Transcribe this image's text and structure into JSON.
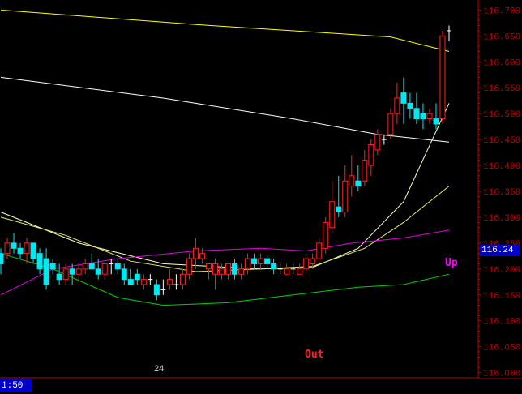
{
  "chart_data": {
    "type": "candlestick",
    "ylim": [
      115.99,
      116.71
    ],
    "y_ticks": [
      "116.000",
      "116.050",
      "116.100",
      "116.150",
      "116.200",
      "116.250",
      "116.300",
      "116.350",
      "116.400",
      "116.450",
      "116.500",
      "116.550",
      "116.600",
      "116.650",
      "116.700"
    ],
    "y_tick_values": [
      116.0,
      116.05,
      116.1,
      116.15,
      116.2,
      116.25,
      116.3,
      116.35,
      116.4,
      116.45,
      116.5,
      116.55,
      116.6,
      116.65,
      116.7
    ],
    "candles": [
      {
        "o": 116.23,
        "h": 116.24,
        "l": 116.19,
        "c": 116.21,
        "up": false
      },
      {
        "o": 116.23,
        "h": 116.26,
        "l": 116.22,
        "c": 116.25,
        "up": true
      },
      {
        "o": 116.25,
        "h": 116.27,
        "l": 116.23,
        "c": 116.24,
        "up": false
      },
      {
        "o": 116.24,
        "h": 116.25,
        "l": 116.22,
        "c": 116.23,
        "up": false
      },
      {
        "o": 116.23,
        "h": 116.26,
        "l": 116.21,
        "c": 116.25,
        "up": true
      },
      {
        "o": 116.25,
        "h": 116.25,
        "l": 116.21,
        "c": 116.22,
        "up": false
      },
      {
        "o": 116.23,
        "h": 116.24,
        "l": 116.19,
        "c": 116.2,
        "up": false
      },
      {
        "o": 116.22,
        "h": 116.24,
        "l": 116.16,
        "c": 116.17,
        "up": false
      },
      {
        "o": 116.21,
        "h": 116.22,
        "l": 116.19,
        "c": 116.2,
        "up": false
      },
      {
        "o": 116.19,
        "h": 116.21,
        "l": 116.17,
        "c": 116.18,
        "up": false
      },
      {
        "o": 116.18,
        "h": 116.21,
        "l": 116.17,
        "c": 116.2,
        "up": true
      },
      {
        "o": 116.2,
        "h": 116.21,
        "l": 116.17,
        "c": 116.19,
        "up": false
      },
      {
        "o": 116.19,
        "h": 116.21,
        "l": 116.18,
        "c": 116.2,
        "up": true
      },
      {
        "o": 116.2,
        "h": 116.22,
        "l": 116.19,
        "c": 116.21,
        "up": true
      },
      {
        "o": 116.21,
        "h": 116.23,
        "l": 116.2,
        "c": 116.2,
        "up": false
      },
      {
        "o": 116.2,
        "h": 116.22,
        "l": 116.18,
        "c": 116.19,
        "up": false
      },
      {
        "o": 116.19,
        "h": 116.21,
        "l": 116.18,
        "c": 116.21,
        "up": true
      },
      {
        "o": 116.21,
        "h": 116.22,
        "l": 116.19,
        "c": 116.21,
        "up": false
      },
      {
        "o": 116.21,
        "h": 116.22,
        "l": 116.19,
        "c": 116.2,
        "up": false
      },
      {
        "o": 116.2,
        "h": 116.21,
        "l": 116.17,
        "c": 116.18,
        "up": false
      },
      {
        "o": 116.18,
        "h": 116.2,
        "l": 116.17,
        "c": 116.17,
        "up": false
      },
      {
        "o": 116.18,
        "h": 116.2,
        "l": 116.17,
        "c": 116.19,
        "up": false
      },
      {
        "o": 116.17,
        "h": 116.19,
        "l": 116.16,
        "c": 116.18,
        "up": true
      },
      {
        "o": 116.18,
        "h": 116.19,
        "l": 116.17,
        "c": 116.18,
        "up": false
      },
      {
        "o": 116.17,
        "h": 116.18,
        "l": 116.14,
        "c": 116.15,
        "up": false
      },
      {
        "o": 116.16,
        "h": 116.18,
        "l": 116.15,
        "c": 116.16,
        "up": true
      },
      {
        "o": 116.17,
        "h": 116.2,
        "l": 116.16,
        "c": 116.18,
        "up": true
      },
      {
        "o": 116.17,
        "h": 116.19,
        "l": 116.16,
        "c": 116.17,
        "up": false
      },
      {
        "o": 116.17,
        "h": 116.2,
        "l": 116.16,
        "c": 116.19,
        "up": true
      },
      {
        "o": 116.19,
        "h": 116.23,
        "l": 116.18,
        "c": 116.22,
        "up": true
      },
      {
        "o": 116.22,
        "h": 116.26,
        "l": 116.2,
        "c": 116.24,
        "up": true
      },
      {
        "o": 116.22,
        "h": 116.24,
        "l": 116.21,
        "c": 116.23,
        "up": true
      },
      {
        "o": 116.2,
        "h": 116.21,
        "l": 116.18,
        "c": 116.21,
        "up": true
      },
      {
        "o": 116.19,
        "h": 116.22,
        "l": 116.16,
        "c": 116.21,
        "up": true
      },
      {
        "o": 116.19,
        "h": 116.21,
        "l": 116.18,
        "c": 116.2,
        "up": true
      },
      {
        "o": 116.19,
        "h": 116.21,
        "l": 116.18,
        "c": 116.21,
        "up": true
      },
      {
        "o": 116.21,
        "h": 116.22,
        "l": 116.18,
        "c": 116.19,
        "up": false
      },
      {
        "o": 116.19,
        "h": 116.21,
        "l": 116.18,
        "c": 116.2,
        "up": true
      },
      {
        "o": 116.2,
        "h": 116.23,
        "l": 116.19,
        "c": 116.22,
        "up": true
      },
      {
        "o": 116.22,
        "h": 116.23,
        "l": 116.2,
        "c": 116.21,
        "up": false
      },
      {
        "o": 116.21,
        "h": 116.23,
        "l": 116.2,
        "c": 116.22,
        "up": true
      },
      {
        "o": 116.22,
        "h": 116.23,
        "l": 116.2,
        "c": 116.21,
        "up": false
      },
      {
        "o": 116.21,
        "h": 116.22,
        "l": 116.19,
        "c": 116.2,
        "up": false
      },
      {
        "o": 116.2,
        "h": 116.21,
        "l": 116.19,
        "c": 116.2,
        "up": false
      },
      {
        "o": 116.19,
        "h": 116.21,
        "l": 116.19,
        "c": 116.2,
        "up": true
      },
      {
        "o": 116.2,
        "h": 116.21,
        "l": 116.19,
        "c": 116.2,
        "up": false
      },
      {
        "o": 116.19,
        "h": 116.21,
        "l": 116.19,
        "c": 116.2,
        "up": true
      },
      {
        "o": 116.2,
        "h": 116.23,
        "l": 116.19,
        "c": 116.22,
        "up": true
      },
      {
        "o": 116.21,
        "h": 116.23,
        "l": 116.2,
        "c": 116.22,
        "up": true
      },
      {
        "o": 116.22,
        "h": 116.26,
        "l": 116.21,
        "c": 116.25,
        "up": true
      },
      {
        "o": 116.24,
        "h": 116.3,
        "l": 116.23,
        "c": 116.29,
        "up": true
      },
      {
        "o": 116.28,
        "h": 116.37,
        "l": 116.27,
        "c": 116.33,
        "up": true
      },
      {
        "o": 116.32,
        "h": 116.38,
        "l": 116.3,
        "c": 116.31,
        "up": false
      },
      {
        "o": 116.31,
        "h": 116.4,
        "l": 116.3,
        "c": 116.37,
        "up": true
      },
      {
        "o": 116.36,
        "h": 116.42,
        "l": 116.34,
        "c": 116.38,
        "up": true
      },
      {
        "o": 116.37,
        "h": 116.4,
        "l": 116.35,
        "c": 116.36,
        "up": false
      },
      {
        "o": 116.37,
        "h": 116.43,
        "l": 116.36,
        "c": 116.41,
        "up": true
      },
      {
        "o": 116.4,
        "h": 116.45,
        "l": 116.38,
        "c": 116.44,
        "up": true
      },
      {
        "o": 116.43,
        "h": 116.47,
        "l": 116.42,
        "c": 116.46,
        "up": true
      },
      {
        "o": 116.45,
        "h": 116.46,
        "l": 116.44,
        "c": 116.45,
        "up": true
      },
      {
        "o": 116.46,
        "h": 116.51,
        "l": 116.45,
        "c": 116.5,
        "up": true
      },
      {
        "o": 116.5,
        "h": 116.56,
        "l": 116.48,
        "c": 116.53,
        "up": true
      },
      {
        "o": 116.54,
        "h": 116.57,
        "l": 116.48,
        "c": 116.52,
        "up": false
      },
      {
        "o": 116.52,
        "h": 116.54,
        "l": 116.49,
        "c": 116.51,
        "up": false
      },
      {
        "o": 116.51,
        "h": 116.54,
        "l": 116.48,
        "c": 116.49,
        "up": false
      },
      {
        "o": 116.5,
        "h": 116.52,
        "l": 116.47,
        "c": 116.49,
        "up": false
      },
      {
        "o": 116.49,
        "h": 116.51,
        "l": 116.48,
        "c": 116.5,
        "up": true
      },
      {
        "o": 116.49,
        "h": 116.52,
        "l": 116.47,
        "c": 116.48,
        "up": false
      },
      {
        "o": 116.49,
        "h": 116.66,
        "l": 116.48,
        "c": 116.65,
        "up": true
      },
      {
        "o": 116.66,
        "h": 116.67,
        "l": 116.64,
        "c": 116.66,
        "up": true
      }
    ],
    "lines": [
      {
        "color": "#ffff00",
        "points": [
          [
            0,
            116.7
          ],
          [
            30,
            116.672
          ],
          [
            60,
            116.648
          ],
          [
            69,
            116.62
          ]
        ]
      },
      {
        "color": "#fffff0",
        "points": [
          [
            0,
            116.57
          ],
          [
            25,
            116.53
          ],
          [
            45,
            116.49
          ],
          [
            58,
            116.46
          ],
          [
            69,
            116.445
          ]
        ]
      },
      {
        "color": "#ffffc0",
        "points": [
          [
            0,
            116.31
          ],
          [
            12,
            116.25
          ],
          [
            25,
            116.21
          ],
          [
            40,
            116.2
          ],
          [
            48,
            116.203
          ],
          [
            55,
            116.24
          ],
          [
            62,
            116.33
          ],
          [
            69,
            116.52
          ]
        ]
      },
      {
        "color": "#e8e870",
        "points": [
          [
            0,
            116.3
          ],
          [
            10,
            116.265
          ],
          [
            20,
            116.215
          ],
          [
            30,
            116.195
          ],
          [
            40,
            116.2
          ],
          [
            48,
            116.205
          ],
          [
            56,
            116.24
          ],
          [
            62,
            116.29
          ],
          [
            69,
            116.36
          ]
        ]
      },
      {
        "color": "#e000e0",
        "points": [
          [
            0,
            116.15
          ],
          [
            8,
            116.2
          ],
          [
            18,
            116.22
          ],
          [
            30,
            116.235
          ],
          [
            40,
            116.24
          ],
          [
            47,
            116.235
          ],
          [
            54,
            116.25
          ],
          [
            62,
            116.26
          ],
          [
            69,
            116.275
          ]
        ]
      },
      {
        "color": "#00d000",
        "points": [
          [
            0,
            116.23
          ],
          [
            8,
            116.2
          ],
          [
            18,
            116.145
          ],
          [
            25,
            116.13
          ],
          [
            35,
            116.135
          ],
          [
            45,
            116.15
          ],
          [
            55,
            116.165
          ],
          [
            62,
            116.17
          ],
          [
            69,
            116.19
          ]
        ]
      }
    ]
  },
  "overlay": {
    "current_price": "116.24",
    "time": "1:50",
    "date_marker": "24",
    "signal_up": "Up",
    "signal_out": "Out"
  },
  "colors": {
    "candle_up": "#ff2020",
    "candle_down": "#00e8f0",
    "doji": "#ffffff",
    "axis": "#c00000",
    "grid": "#900000"
  }
}
